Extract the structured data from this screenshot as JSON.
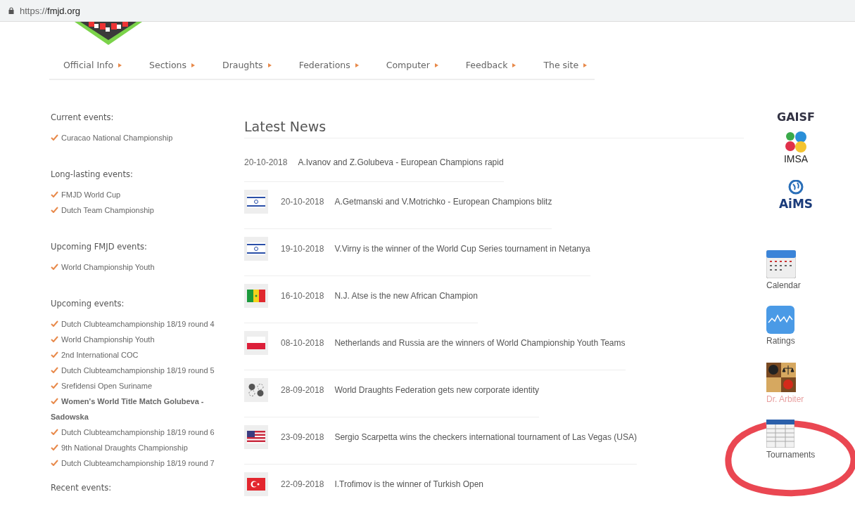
{
  "browser": {
    "url_prefix": "https://",
    "url_host": "fmjd.org"
  },
  "nav": [
    "Official Info",
    "Sections",
    "Draughts",
    "Federations",
    "Computer",
    "Feedback",
    "The site"
  ],
  "sidebar": [
    {
      "heading": "Current events:",
      "items": [
        {
          "text": "Curacao National Championship",
          "bold": false
        }
      ]
    },
    {
      "heading": "Long-lasting events:",
      "items": [
        {
          "text": "FMJD World Cup",
          "bold": false
        },
        {
          "text": "Dutch Team Championship",
          "bold": false
        }
      ]
    },
    {
      "heading": "Upcoming FMJD events:",
      "items": [
        {
          "text": "World Championship Youth",
          "bold": false
        }
      ]
    },
    {
      "heading": "Upcoming events:",
      "items": [
        {
          "text": "Dutch Clubteamchampionship 18/19 round 4",
          "bold": false
        },
        {
          "text": "World Championship Youth",
          "bold": false
        },
        {
          "text": "2nd International COC",
          "bold": false
        },
        {
          "text": "Dutch Clubteamchampionship 18/19 round 5",
          "bold": false
        },
        {
          "text": "Srefidensi Open Suriname",
          "bold": false
        },
        {
          "text": "Women's World Title Match Golubeva - Sadowska",
          "bold": true
        },
        {
          "text": "Dutch Clubteamchampionship 18/19 round 6",
          "bold": false
        },
        {
          "text": "9th National Draughts Championship",
          "bold": false
        },
        {
          "text": "Dutch Clubteamchampionship 18/19 round 7",
          "bold": false
        }
      ]
    },
    {
      "heading": "Recent events:"
    }
  ],
  "news": {
    "title": "Latest News",
    "items": [
      {
        "date": "20-10-2018",
        "title": "A.Ivanov and Z.Golubeva - European Champions rapid",
        "kind": "text"
      },
      {
        "date": "20-10-2018",
        "title": "A.Getmanski and V.Motrichko - European Champions blitz",
        "kind": "israel"
      },
      {
        "date": "19-10-2018",
        "title": "V.Virny is the winner of the World Cup Series tournament in Netanya",
        "kind": "israel"
      },
      {
        "date": "16-10-2018",
        "title": "N.J. Atse is the new African Champion",
        "kind": "senegal"
      },
      {
        "date": "08-10-2018",
        "title": "Netherlands and Russia are the winners of World Championship Youth Teams",
        "kind": "poland"
      },
      {
        "date": "28-09-2018",
        "title": "World Draughts Federation gets new corporate identity",
        "kind": "draughts"
      },
      {
        "date": "23-09-2018",
        "title": "Sergio Scarpetta wins the checkers international tournament of Las Vegas (USA)",
        "kind": "usa"
      },
      {
        "date": "22-09-2018",
        "title": "I.Trofimov is the winner of Turkish Open",
        "kind": "turkey"
      }
    ]
  },
  "links": [
    {
      "kind": "gaisf",
      "label": "GAISF"
    },
    {
      "kind": "imsa",
      "label": "IMSA"
    },
    {
      "kind": "aims",
      "label": "AiMS"
    },
    {
      "kind": "calendar",
      "label": "Calendar"
    },
    {
      "kind": "ratings",
      "label": "Ratings"
    },
    {
      "kind": "arbiter",
      "label": "Dr. Arbiter"
    },
    {
      "kind": "tournaments",
      "label": "Tournaments"
    }
  ]
}
